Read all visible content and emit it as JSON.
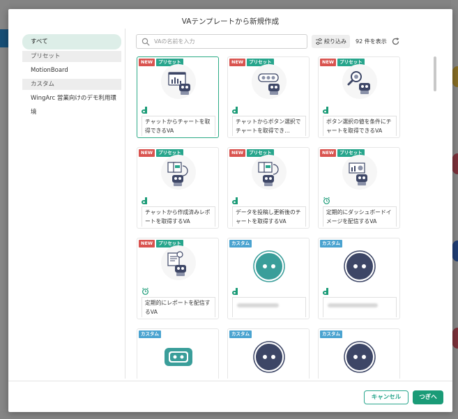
{
  "dialog": {
    "title": "VAテンプレートから新規作成"
  },
  "sidebar": {
    "items": [
      {
        "label": "すべて",
        "type": "item",
        "active": true
      },
      {
        "label": "プリセット",
        "type": "section"
      },
      {
        "label": "MotionBoard",
        "type": "item"
      },
      {
        "label": "カスタム",
        "type": "section"
      },
      {
        "label": "WingArc 営業向けのデモ利用環境",
        "type": "item"
      }
    ]
  },
  "toolbar": {
    "search_placeholder": "VAの名前を入力",
    "search_value": "",
    "filter_label": "絞り込み",
    "count_label": "92 件を表示"
  },
  "badges": {
    "new": "NEW",
    "preset": "プリセット",
    "custom": "カスタム"
  },
  "cards": [
    {
      "title": "チャットからチャートを取得できるVA",
      "badges": [
        "new",
        "preset"
      ],
      "icon": "chart-robot-icon",
      "source": "motionboard",
      "selected": true
    },
    {
      "title": "チャットからボタン選択でチャートを取得でき…",
      "badges": [
        "new",
        "preset"
      ],
      "icon": "buttons-robot-icon",
      "source": "motionboard"
    },
    {
      "title": "ボタン選択の値を条件にチャートを取得できるVA",
      "badges": [
        "new",
        "preset"
      ],
      "icon": "search-robot-icon",
      "source": "motionboard"
    },
    {
      "title": "チャットから作成済みレポートを取得するVA",
      "badges": [
        "new",
        "preset"
      ],
      "icon": "report-robot-icon",
      "source": "motionboard"
    },
    {
      "title": "データを投稿し更新後のチャートを取得するVA",
      "badges": [
        "new",
        "preset"
      ],
      "icon": "upload-robot-icon",
      "source": "motionboard"
    },
    {
      "title": "定期的にダッシュボードイメージを配信するVA",
      "badges": [
        "new",
        "preset"
      ],
      "icon": "dashboard-robot-icon",
      "source": "timer"
    },
    {
      "title": "定期的にレポートを配信するVA",
      "badges": [
        "new",
        "preset"
      ],
      "icon": "scheduled-report-robot-icon",
      "source": "timer"
    },
    {
      "title": "",
      "badges": [
        "custom"
      ],
      "icon": "teal-robot-face-icon",
      "source": "motionboard",
      "blurred": true
    },
    {
      "title": "",
      "badges": [
        "custom"
      ],
      "icon": "navy-robot-face-icon",
      "source": "motionboard",
      "blurred": true
    },
    {
      "title": "",
      "badges": [
        "custom"
      ],
      "icon": "teal-square-robot-icon",
      "source": "motionboard"
    },
    {
      "title": "",
      "badges": [
        "custom"
      ],
      "icon": "navy-robot-face-icon",
      "source": "motionboard"
    },
    {
      "title": "",
      "badges": [
        "custom"
      ],
      "icon": "navy-robot-face-icon",
      "source": "motionboard"
    }
  ],
  "footer": {
    "cancel_label": "キャンセル",
    "next_label": "つぎへ"
  },
  "colors": {
    "accent": "#1a9b77",
    "new_badge": "#d9534f",
    "preset_badge": "#27a58c",
    "custom_badge": "#4aa3d0",
    "navy": "#3d4666",
    "teal": "#3a9e9a"
  }
}
